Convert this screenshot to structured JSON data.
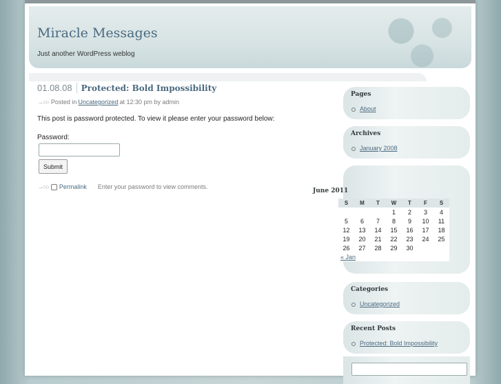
{
  "blog": {
    "title": "Miracle Messages",
    "description": "Just another WordPress weblog"
  },
  "post": {
    "date": "01.08.08",
    "title": "Protected: Bold Impossibility",
    "meta_prefix": "Posted in",
    "category": "Uncategorized",
    "meta_suffix": "at 12:30 pm by admin",
    "protected_text": "This post is password protected. To view it please enter your password below:",
    "password_label": "Password:",
    "submit_label": "Submit",
    "permalink_label": "Permalink",
    "comments_note": "Enter your password to view comments."
  },
  "sidebar": {
    "pages": {
      "title": "Pages",
      "items": [
        "About"
      ]
    },
    "archives": {
      "title": "Archives",
      "items": [
        "January 2008"
      ]
    },
    "calendar": {
      "caption": "June 2011",
      "weekdays": [
        "S",
        "M",
        "T",
        "W",
        "T",
        "F",
        "S"
      ],
      "weeks": [
        [
          "",
          "",
          "",
          "1",
          "2",
          "3",
          "4"
        ],
        [
          "5",
          "6",
          "7",
          "8",
          "9",
          "10",
          "11"
        ],
        [
          "12",
          "13",
          "14",
          "15",
          "16",
          "17",
          "18"
        ],
        [
          "19",
          "20",
          "21",
          "22",
          "23",
          "24",
          "25"
        ],
        [
          "26",
          "27",
          "28",
          "29",
          "30",
          "",
          ""
        ]
      ],
      "prev_label": "« Jan"
    },
    "categories": {
      "title": "Categories",
      "items": [
        "Uncategorized"
      ]
    },
    "recent_posts": {
      "title": "Recent Posts",
      "items": [
        "Protected: Bold Impossibility"
      ]
    }
  },
  "colors": {
    "link": "#4a6a80",
    "background": "#b9ccce",
    "header": "#d7e3e4"
  }
}
